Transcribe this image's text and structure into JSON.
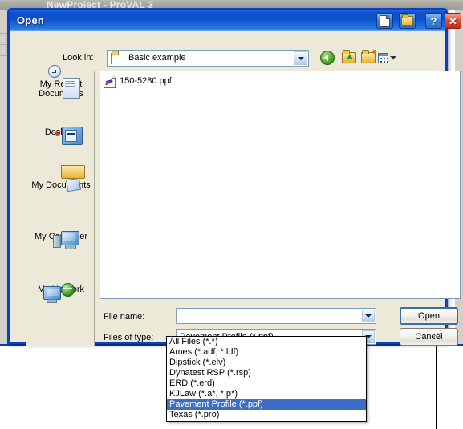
{
  "background_window": {
    "title": "NewProject - ProVAL 3"
  },
  "dialog": {
    "title": "Open",
    "titlebar_buttons": [
      {
        "name": "new-document",
        "icon": "page-icon",
        "glyph": ""
      },
      {
        "name": "new-folder",
        "icon": "folder-icon",
        "glyph": ""
      },
      {
        "name": "help",
        "icon": "question-icon",
        "glyph": "?"
      },
      {
        "name": "close",
        "icon": "close-icon",
        "glyph": "✕"
      }
    ],
    "lookin": {
      "label": "Look in:",
      "value": "Basic example",
      "icon": "open-folder-icon"
    },
    "toolbar": [
      {
        "name": "back-button",
        "icon": "back-arrow-icon",
        "tooltip": "Back"
      },
      {
        "name": "up-one-level-button",
        "icon": "folder-up-icon",
        "tooltip": "Up One Level"
      },
      {
        "name": "create-new-folder-button",
        "icon": "new-folder-icon",
        "tooltip": "Create New Folder"
      },
      {
        "name": "views-button",
        "icon": "views-grid-icon",
        "tooltip": "Views"
      }
    ],
    "places": [
      {
        "label_line1": "My Recent",
        "label_line2": "Documents",
        "icon": "recent-documents-icon"
      },
      {
        "label_line1": "Desktop",
        "label_line2": "",
        "icon": "desktop-icon"
      },
      {
        "label_line1": "My Documents",
        "label_line2": "",
        "icon": "my-documents-icon"
      },
      {
        "label_line1": "My Computer",
        "label_line2": "",
        "icon": "my-computer-icon"
      },
      {
        "label_line1": "My Network",
        "label_line2": "",
        "icon": "my-network-icon"
      }
    ],
    "files": [
      {
        "name": "150-5280.ppf",
        "icon": "ppf-file-icon"
      }
    ],
    "filename": {
      "label": "File name:",
      "value": "",
      "placeholder": ""
    },
    "filetype": {
      "label": "Files of type:",
      "value": "Pavement Profile (*.ppf)",
      "options": [
        "All Files (*.*)",
        "Ames (*.adf, *.ldf)",
        "Dipstick (*.elv)",
        "Dynatest RSP (*.rsp)",
        "ERD (*.erd)",
        "KJLaw (*.a*, *.p*)",
        "Pavement Profile (*.ppf)",
        "Texas (*.pro)"
      ],
      "selected_index": 6,
      "expanded": true
    },
    "buttons": {
      "open": "Open",
      "cancel": "Cancel"
    }
  },
  "colors": {
    "titlebar_blue": "#0d4fc9",
    "dialog_face": "#ece9d8",
    "selection_blue": "#3c6ec8",
    "close_red": "#c72c16",
    "field_border": "#7f9db9"
  }
}
